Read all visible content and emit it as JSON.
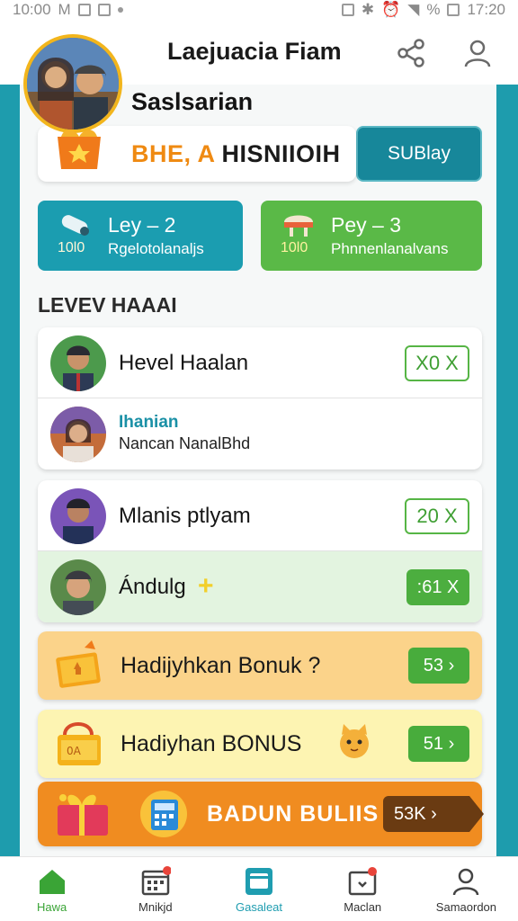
{
  "status_bar": {
    "time": "10:00",
    "left_letters": "M",
    "right_percent": "%",
    "right_time": "17:20"
  },
  "header": {
    "title": "Laejuacia Fiam",
    "share_icon": "share-icon",
    "profile_icon": "user-icon"
  },
  "user": {
    "name": "Saslsarian"
  },
  "promo": {
    "text_a": "BHE, A",
    "text_b": "HISNIIOIH",
    "button_label": "SUBlay"
  },
  "key_cards": [
    {
      "title": "Ley – 2",
      "number": "10l0",
      "subtitle": "Rgelotolanaljs",
      "color": "#1b9db0"
    },
    {
      "title": "Pey – 3",
      "number": "10l0",
      "subtitle": "Phnnenlanalvans",
      "color": "#5ab947"
    }
  ],
  "section": {
    "title": "LEVEV HAAAI"
  },
  "list_group_1": [
    {
      "name": "Hevel Haalan",
      "pill": "X0 X"
    },
    {
      "title": "Ihanian",
      "subtitle": "Nancan NanalBhd"
    }
  ],
  "list_group_2": [
    {
      "name": "Mlanis ptlyam",
      "pill": "20 X"
    },
    {
      "name": "Ándulg",
      "pill": ":61 X"
    }
  ],
  "bonuses": [
    {
      "label": "Hadijyhkan Bonuk ?",
      "pill": "53 ›"
    },
    {
      "label": "Hadiyhan BONUS",
      "pill": "51 ›"
    },
    {
      "label": "BADUN BULIIS",
      "pill": "53K ›"
    }
  ],
  "bottom_nav": [
    {
      "label": "Hawa",
      "icon": "home-icon"
    },
    {
      "label": "Mnikjd",
      "icon": "calendar-icon"
    },
    {
      "label": "Gasaleat",
      "icon": "card-icon"
    },
    {
      "label": "Maclan",
      "icon": "mail-icon"
    },
    {
      "label": "Samaordon",
      "icon": "profile-icon"
    }
  ],
  "colors": {
    "teal": "#1e9cad",
    "green": "#4cae3f",
    "orange": "#f08c20"
  }
}
